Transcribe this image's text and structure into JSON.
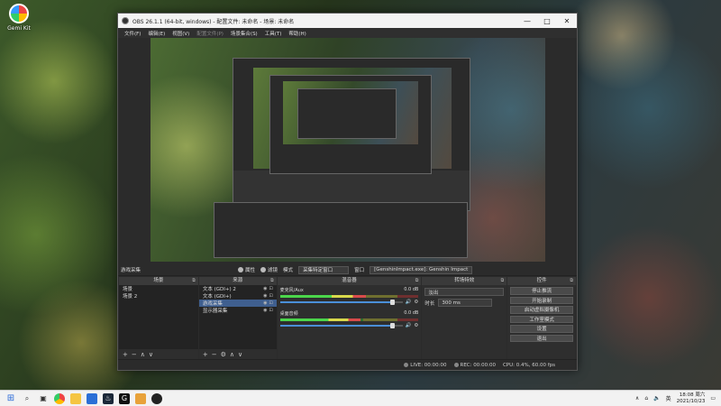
{
  "desktop": {
    "icon_label": "Gemi Kit"
  },
  "window": {
    "title": "OBS 26.1.1 (64-bit, windows) - 配置文件: 未命名 - 场景: 未命名",
    "controls": {
      "minimize": "—",
      "maximize": "□",
      "close": "✕"
    }
  },
  "menu": [
    "文件(F)",
    "编辑(E)",
    "视图(V)",
    "配置文件(P)",
    "场景集合(S)",
    "工具(T)",
    "帮助(H)"
  ],
  "source_toolbar": {
    "source_name": "游戏采集",
    "properties": "属性",
    "filters": "滤镜",
    "mode_label": "模式",
    "mode_value": "采集特定窗口",
    "window_label": "窗口",
    "window_value": "[GenshinImpact.exe]: Genshin Impact"
  },
  "docks": {
    "scenes": {
      "title": "场景",
      "items": [
        "场景",
        "场景 2"
      ]
    },
    "sources": {
      "title": "来源",
      "items": [
        "文本 (GDI+) 2",
        "文本 (GDI+)",
        "游戏采集",
        "显示器采集"
      ]
    },
    "mixer": {
      "title": "混音器",
      "channels": [
        {
          "name": "麦克风/Aux",
          "db": "0.0 dB",
          "level": 0.62,
          "volume": 0.92
        },
        {
          "name": "桌面音频",
          "db": "0.0 dB",
          "level": 0.58,
          "volume": 0.92
        }
      ]
    },
    "transitions": {
      "title": "转场特效",
      "selected": "淡出",
      "duration_label": "时长",
      "duration_value": "300 ms"
    },
    "controls": {
      "title": "控件",
      "buttons": [
        "停止推流",
        "开始录制",
        "启动虚拟摄像机",
        "工作室模式",
        "设置",
        "退出"
      ]
    }
  },
  "statusbar": {
    "live": "LIVE: 00:00:00",
    "rec": "REC: 00:00:00",
    "cpu": "CPU: 0.4%, 60.00 fps"
  },
  "taskbar": {
    "time": "18:08 周六",
    "date": "2021/10/23",
    "lang": "英"
  }
}
